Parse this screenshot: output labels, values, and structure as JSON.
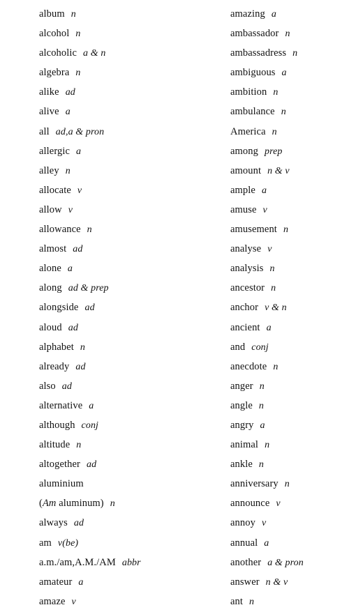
{
  "page": {
    "kind": "dictionary-word-list-page",
    "background_color": "#ffffff",
    "text_color": "#111111",
    "column_count": 2
  },
  "columns": [
    {
      "name": "left-column",
      "entries": [
        {
          "word": "album",
          "pos": "n"
        },
        {
          "word": "alcohol",
          "pos": "n"
        },
        {
          "word": "alcoholic",
          "pos": "a & n"
        },
        {
          "word": "algebra",
          "pos": "n"
        },
        {
          "word": "alike",
          "pos": "ad"
        },
        {
          "word": "alive",
          "pos": "a"
        },
        {
          "word": "all",
          "pos": "ad,a & pron"
        },
        {
          "word": "allergic",
          "pos": "a"
        },
        {
          "word": "alley",
          "pos": "n"
        },
        {
          "word": "allocate",
          "pos": "v"
        },
        {
          "word": "allow",
          "pos": "v"
        },
        {
          "word": "allowance",
          "pos": "n"
        },
        {
          "word": "almost",
          "pos": "ad"
        },
        {
          "word": "alone",
          "pos": "a"
        },
        {
          "word": "along",
          "pos": "ad & prep"
        },
        {
          "word": "alongside",
          "pos": "ad"
        },
        {
          "word": "aloud",
          "pos": "ad"
        },
        {
          "word": "alphabet",
          "pos": "n"
        },
        {
          "word": "already",
          "pos": "ad"
        },
        {
          "word": "also",
          "pos": "ad"
        },
        {
          "word": "alternative",
          "pos": "a"
        },
        {
          "word": "although",
          "pos": "conj"
        },
        {
          "word": "altitude",
          "pos": "n"
        },
        {
          "word": "altogether",
          "pos": "ad"
        },
        {
          "word": "aluminium",
          "pos": ""
        },
        {
          "word": "(Am aluminum)",
          "pos": "n"
        },
        {
          "word": "always",
          "pos": "ad"
        },
        {
          "word": "am",
          "pos": "v(be)"
        },
        {
          "word": "a.m./am,A.M./AM",
          "pos": "abbr"
        },
        {
          "word": "amateur",
          "pos": "a"
        },
        {
          "word": "amaze",
          "pos": "v"
        }
      ]
    },
    {
      "name": "right-column",
      "entries": [
        {
          "word": "amazing",
          "pos": "a"
        },
        {
          "word": "ambassador",
          "pos": "n"
        },
        {
          "word": "ambassadress",
          "pos": "n"
        },
        {
          "word": "ambiguous",
          "pos": "a"
        },
        {
          "word": "ambition",
          "pos": "n"
        },
        {
          "word": "ambulance",
          "pos": "n"
        },
        {
          "word": "America",
          "pos": "n"
        },
        {
          "word": "among",
          "pos": "prep"
        },
        {
          "word": "amount",
          "pos": "n & v"
        },
        {
          "word": "ample",
          "pos": "a"
        },
        {
          "word": "amuse",
          "pos": "v"
        },
        {
          "word": "amusement",
          "pos": "n"
        },
        {
          "word": "analyse",
          "pos": "v"
        },
        {
          "word": "analysis",
          "pos": "n"
        },
        {
          "word": "ancestor",
          "pos": "n"
        },
        {
          "word": "anchor",
          "pos": "v & n"
        },
        {
          "word": "ancient",
          "pos": "a"
        },
        {
          "word": "and",
          "pos": "conj"
        },
        {
          "word": "anecdote",
          "pos": "n"
        },
        {
          "word": "anger",
          "pos": "n"
        },
        {
          "word": "angle",
          "pos": "n"
        },
        {
          "word": "angry",
          "pos": "a"
        },
        {
          "word": "animal",
          "pos": "n"
        },
        {
          "word": "ankle",
          "pos": "n"
        },
        {
          "word": "anniversary",
          "pos": "n"
        },
        {
          "word": "announce",
          "pos": "v"
        },
        {
          "word": "annoy",
          "pos": "v"
        },
        {
          "word": "annual",
          "pos": "a"
        },
        {
          "word": "another",
          "pos": "a & pron"
        },
        {
          "word": "answer",
          "pos": "n & v"
        },
        {
          "word": "ant",
          "pos": "n"
        }
      ]
    }
  ]
}
